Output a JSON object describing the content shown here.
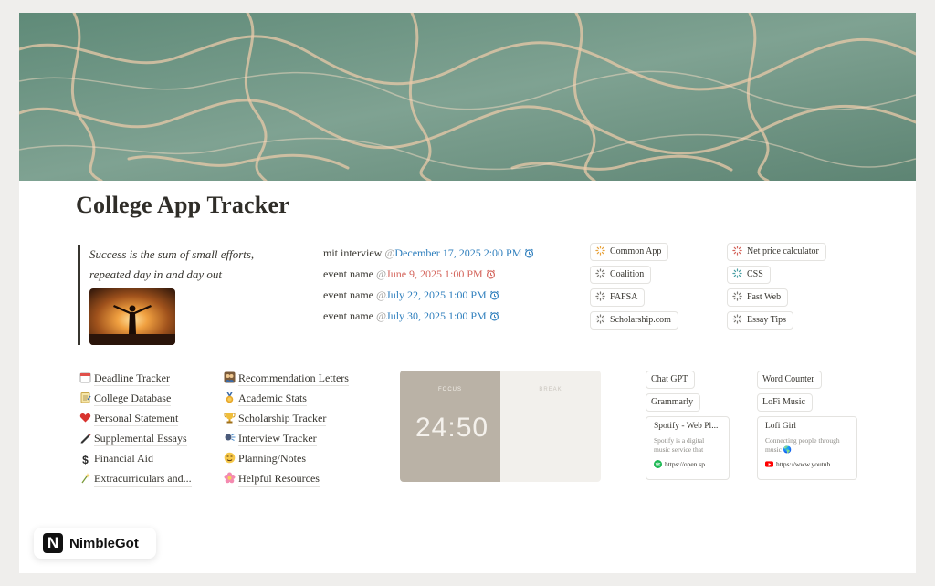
{
  "page": {
    "title": "College App Tracker"
  },
  "quote": {
    "line1": "Success is the sum of small efforts,",
    "line2": "repeated day in and day out"
  },
  "events": [
    {
      "name": "mit interview",
      "date": "December 17, 2025 2:00 PM",
      "color": "#2f7fbd"
    },
    {
      "name": "event name",
      "date": "June 9, 2025 1:00 PM",
      "color": "#d4655c"
    },
    {
      "name": "event name",
      "date": "July 22, 2025 1:00 PM",
      "color": "#2f7fbd"
    },
    {
      "name": "event name",
      "date": "July 30, 2025 1:00 PM",
      "color": "#2f7fbd"
    }
  ],
  "links_col1": [
    "Common App",
    "Coalition",
    "FAFSA",
    "Scholarship.com"
  ],
  "links_col2": [
    "Net price calculator",
    "CSS",
    "Fast Web",
    "Essay Tips"
  ],
  "nav_col1": [
    {
      "label": "Deadline Tracker",
      "icon": "calendar-icon"
    },
    {
      "label": "College Database",
      "icon": "notepad-icon"
    },
    {
      "label": "Personal Statement",
      "icon": "heart-icon"
    },
    {
      "label": "Supplemental Essays",
      "icon": "pen-icon"
    },
    {
      "label": "Financial Aid",
      "icon": "dollar-icon"
    },
    {
      "label": "Extracurriculars and...",
      "icon": "sparkle-icon"
    }
  ],
  "nav_col2": [
    {
      "label": "Recommendation Letters",
      "icon": "people-icon"
    },
    {
      "label": "Academic Stats",
      "icon": "medal-icon"
    },
    {
      "label": "Scholarship Tracker",
      "icon": "trophy-icon"
    },
    {
      "label": "Interview Tracker",
      "icon": "speech-icon"
    },
    {
      "label": "Planning/Notes",
      "icon": "face-icon"
    },
    {
      "label": "Helpful Resources",
      "icon": "flower-icon"
    }
  ],
  "pomodoro": {
    "focus_label": "FOCUS",
    "break_label": "BREAK",
    "time": "24:50"
  },
  "tools_col1": [
    "Chat GPT",
    "Grammarly"
  ],
  "tools_col2": [
    "Word Counter",
    "LoFi Music"
  ],
  "bookmarks": [
    {
      "title": "Spotify - Web Pl...",
      "desc": "Spotify is a digital music service that",
      "url": "https://open.sp...",
      "icon": "spotify-icon"
    },
    {
      "title": "Lofi Girl",
      "desc": "Connecting people through music 🌎",
      "url": "https://www.youtub...",
      "icon": "youtube-icon"
    }
  ],
  "brand": {
    "logo_letter": "N",
    "name": "NimbleGot"
  }
}
